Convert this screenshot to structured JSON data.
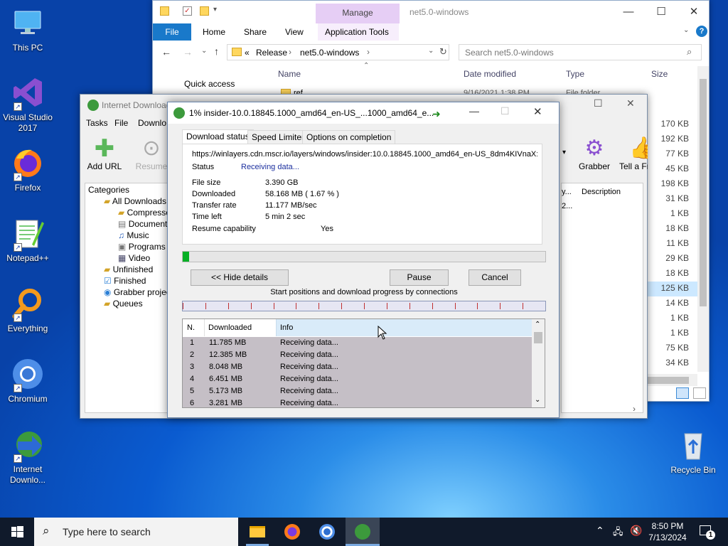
{
  "desktop": {
    "icons": [
      {
        "label": "This PC"
      },
      {
        "label": "Visual Studio 2017"
      },
      {
        "label": "Firefox"
      },
      {
        "label": "Notepad++"
      },
      {
        "label": "Everything"
      },
      {
        "label": "Chromium"
      },
      {
        "label": "Internet Downlo..."
      },
      {
        "label": "Recycle Bin"
      }
    ]
  },
  "explorer": {
    "title": "net5.0-windows",
    "manage": "Manage",
    "ribbon_tabs": [
      "File",
      "Home",
      "Share",
      "View",
      "Application Tools"
    ],
    "breadcrumb": [
      "«",
      "Release",
      "net5.0-windows"
    ],
    "search_placeholder": "Search net5.0-windows",
    "quick_access": "Quick access",
    "columns": {
      "name": "Name",
      "date": "Date modified",
      "type": "Type",
      "size": "Size"
    },
    "first_row": {
      "name": "ref",
      "date": "9/16/2021 1:38 PM",
      "type": "File folder"
    },
    "sizes": [
      "170 KB",
      "192 KB",
      "77 KB",
      "45 KB",
      "198 KB",
      "31 KB",
      "1 KB",
      "18 KB",
      "11 KB",
      "29 KB",
      "18 KB",
      "125 KB",
      "14 KB",
      "1 KB",
      "1 KB",
      "75 KB",
      "34 KB"
    ]
  },
  "idm": {
    "title": "Internet Download",
    "menu": [
      "Tasks",
      "File",
      "Downlo"
    ],
    "toolbar": {
      "add_url": "Add URL",
      "resume": "Resume",
      "grabber": "Grabber",
      "tell": "Tell a Fri"
    },
    "categories_header": "Categories",
    "tree": [
      "All Downloads",
      "Compresse",
      "Documents",
      "Music",
      "Programs",
      "Video",
      "Unfinished",
      "Finished",
      "Grabber projec",
      "Queues"
    ],
    "right_cols": {
      "c1": "y...",
      "description": "Description"
    },
    "right_val": "2..."
  },
  "dialog": {
    "title": "1% insider-10.0.18845.1000_amd64_en-US_...1000_amd64_e...",
    "tabs": [
      "Download status",
      "Speed Limiter",
      "Options on completion"
    ],
    "url": "https://winlayers.cdn.mscr.io/layers/windows/insider:10.0.18845.1000_amd64_en-US_8dm4KIVnaX:",
    "status_label": "Status",
    "status_value": "Receiving data...",
    "file_size_label": "File size",
    "file_size": "3.390  GB",
    "downloaded_label": "Downloaded",
    "downloaded": "58.168  MB  ( 1.67 % )",
    "rate_label": "Transfer rate",
    "rate": "11.177  MB/sec",
    "time_left_label": "Time left",
    "time_left": "5 min 2 sec",
    "resume_label": "Resume capability",
    "resume": "Yes",
    "progress": 0.0167,
    "hide_details": "<< Hide details",
    "pause": "Pause",
    "cancel": "Cancel",
    "connections_caption": "Start positions and download progress by connections",
    "table_headers": {
      "n": "N.",
      "downloaded": "Downloaded",
      "info": "Info"
    },
    "rows": [
      {
        "n": "1",
        "downloaded": "11.785  MB",
        "info": "Receiving data..."
      },
      {
        "n": "2",
        "downloaded": "12.385  MB",
        "info": "Receiving data..."
      },
      {
        "n": "3",
        "downloaded": "8.048  MB",
        "info": "Receiving data..."
      },
      {
        "n": "4",
        "downloaded": "6.451  MB",
        "info": "Receiving data..."
      },
      {
        "n": "5",
        "downloaded": "5.173  MB",
        "info": "Receiving data..."
      },
      {
        "n": "6",
        "downloaded": "3.281  MB",
        "info": "Receiving data..."
      }
    ]
  },
  "taskbar": {
    "search_placeholder": "Type here to search",
    "time": "8:50 PM",
    "date": "7/13/2024",
    "notification_count": "1"
  },
  "colors": {
    "accent": "#0078d7",
    "progress": "#06b025",
    "selection": "#c5bfc6"
  }
}
